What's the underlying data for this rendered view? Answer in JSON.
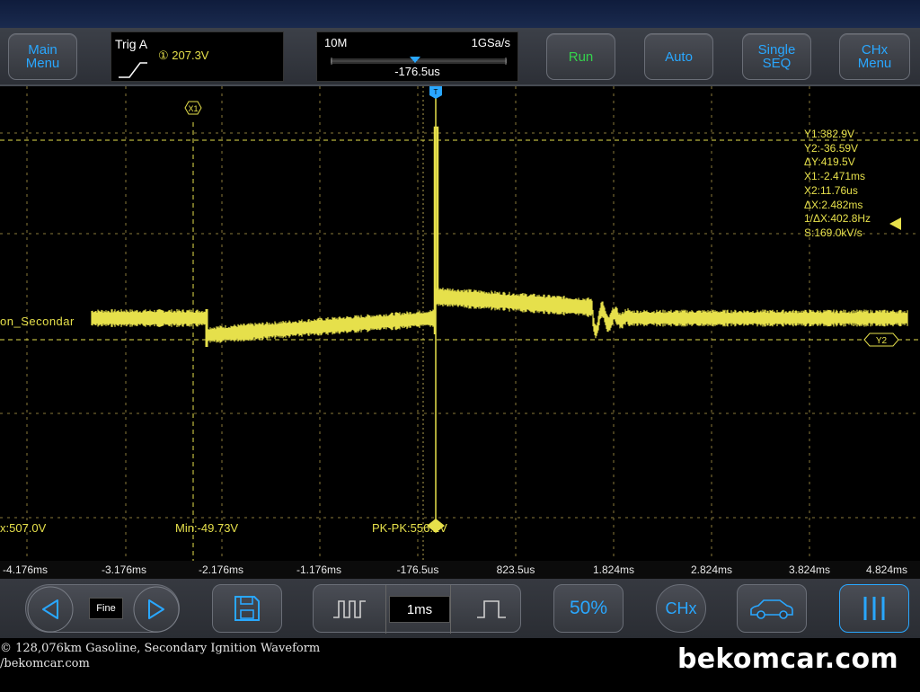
{
  "toolbar": {
    "main_menu": [
      "Main",
      "Menu"
    ],
    "trigger": {
      "label": "Trig A",
      "source": "① 207.3V"
    },
    "timebase": {
      "memory": "10M",
      "sample_rate": "1GSa/s",
      "position": "-176.5us"
    },
    "run": "Run",
    "auto": "Auto",
    "single": [
      "Single",
      "SEQ"
    ],
    "chx_menu": [
      "CHx",
      "Menu"
    ]
  },
  "screen": {
    "channel_label": "on_Secondar",
    "cursor_labels": {
      "x1": "X1",
      "y2": "Y2",
      "trigger_marker": "T"
    },
    "readout": {
      "y1": "Y1:382.9V",
      "y2": "Y2:-36.59V",
      "dy": "ΔY:419.5V",
      "x1": "X1:-2.471ms",
      "x2": "X2:11.76us",
      "dx": "ΔX:2.482ms",
      "inv_dx": "1/ΔX:402.8Hz",
      "slope": "S:169.0kV/s"
    },
    "measurements": {
      "max": "x:507.0V",
      "min": "Min:-49.73V",
      "pkpk": "PK-PK:556.2V"
    },
    "trace_color": "#e6e04b"
  },
  "xaxis_ticks": [
    "-4.176ms",
    "-3.176ms",
    "-2.176ms",
    "-1.176ms",
    "-176.5us",
    "823.5us",
    "1.824ms",
    "2.824ms",
    "3.824ms",
    "4.824ms"
  ],
  "bottom": {
    "fine": "Fine",
    "timebase_value": "1ms",
    "fifty": "50%",
    "chx": "CHx",
    "icons": [
      "left-arrow-icon",
      "right-arrow-icon",
      "save-icon",
      "wide-pulse-icon",
      "narrow-pulse-icon",
      "car-icon",
      "menu-bars-icon"
    ]
  },
  "footer": {
    "caption_line1": "© 128,076km Gasoline, Secondary Ignition Waveform",
    "caption_line2": "/bekomcar.com",
    "watermark": "bekomcar.com"
  }
}
